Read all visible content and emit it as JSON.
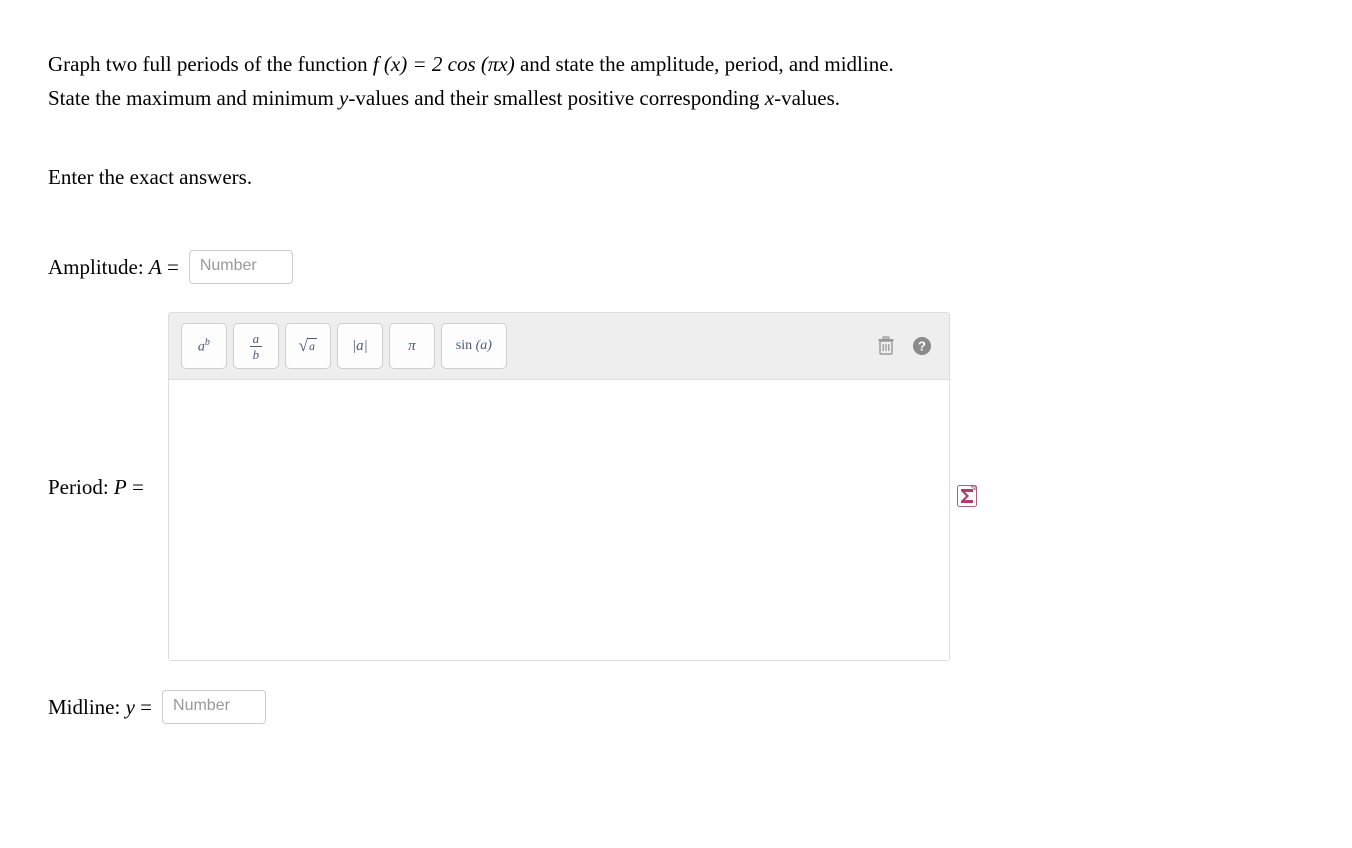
{
  "question": {
    "line1_pre": "Graph two full periods of the function ",
    "fn_lhs": "f (x) = 2 cos (πx)",
    "line1_post": " and state the amplitude, period, and midline.",
    "line2": "State the maximum and minimum y-values and their smallest positive corresponding x-values."
  },
  "instruction": "Enter the exact answers.",
  "amplitude": {
    "label_text": "Amplitude: ",
    "var": "A",
    "eq": " = ",
    "placeholder": "Number"
  },
  "period": {
    "label_text": "Period: ",
    "var": "P",
    "eq": " = "
  },
  "midline": {
    "label_text": "Midline: ",
    "var": "y",
    "eq": " = ",
    "placeholder": "Number"
  },
  "toolbar": {
    "power": {
      "base": "a",
      "exp": "b"
    },
    "fraction": {
      "num": "a",
      "den": "b"
    },
    "sqrt": {
      "arg": "a"
    },
    "abs": "|a|",
    "pi": "π",
    "sin": {
      "fn": "sin",
      "arg": "(a)"
    }
  }
}
